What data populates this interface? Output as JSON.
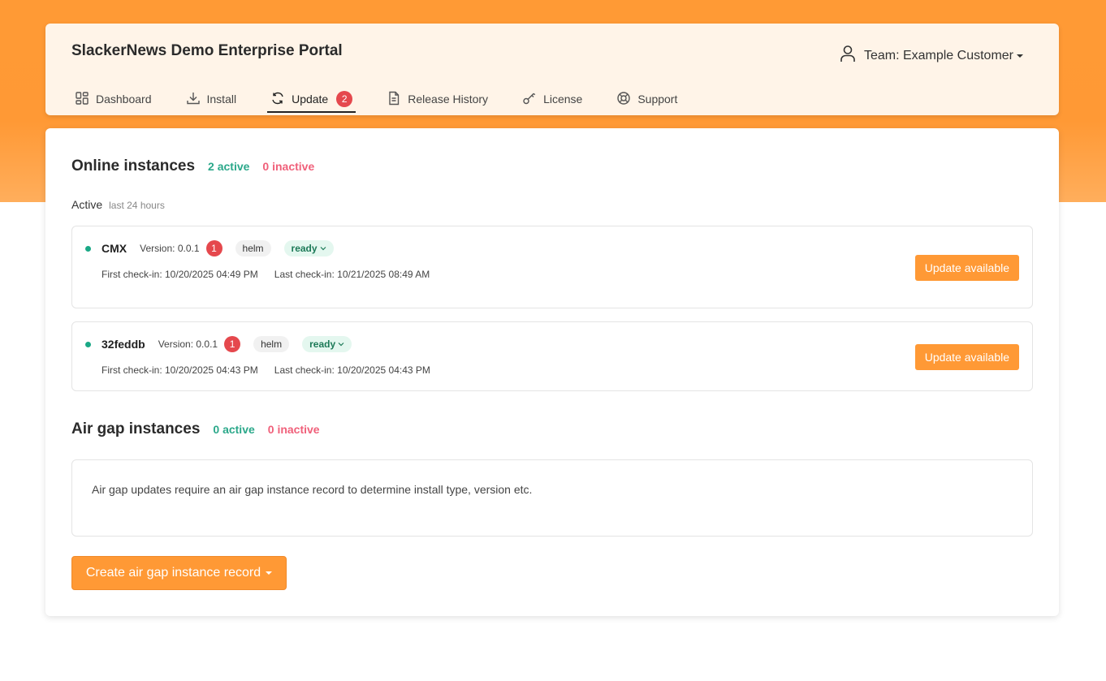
{
  "header": {
    "title": "SlackerNews Demo Enterprise Portal",
    "team_label": "Team: Example Customer",
    "user_icon": "user-icon"
  },
  "nav": {
    "items": [
      {
        "label": "Dashboard",
        "icon": "dashboard-icon"
      },
      {
        "label": "Install",
        "icon": "download-icon"
      },
      {
        "label": "Update",
        "icon": "refresh-icon",
        "badge": "2",
        "active": true
      },
      {
        "label": "Release History",
        "icon": "document-icon"
      },
      {
        "label": "License",
        "icon": "key-icon"
      },
      {
        "label": "Support",
        "icon": "lifebuoy-icon"
      }
    ]
  },
  "online": {
    "title": "Online instances",
    "active_count": "2 active",
    "inactive_count": "0 inactive",
    "active_label": "Active",
    "active_sub": "last 24 hours",
    "instances": [
      {
        "name": "CMX",
        "version": "Version: 0.0.1",
        "update_count": "1",
        "type": "helm",
        "status": "ready",
        "first_checkin": "First check-in: 10/20/2025 04:49 PM",
        "last_checkin": "Last check-in: 10/21/2025 08:49 AM",
        "button": "Update available"
      },
      {
        "name": "32feddb",
        "version": "Version: 0.0.1",
        "update_count": "1",
        "type": "helm",
        "status": "ready",
        "first_checkin": "First check-in: 10/20/2025 04:43 PM",
        "last_checkin": "Last check-in: 10/20/2025 04:43 PM",
        "button": "Update available"
      }
    ]
  },
  "airgap": {
    "title": "Air gap instances",
    "active_count": "0 active",
    "inactive_count": "0 inactive",
    "message": "Air gap updates require an air gap instance record to determine install type, version etc.",
    "create_button": "Create air gap instance record"
  },
  "colors": {
    "accent": "#ff9935",
    "active_green": "#2ba88a",
    "inactive_pink": "#f0607a",
    "badge_red": "#e5484d"
  }
}
